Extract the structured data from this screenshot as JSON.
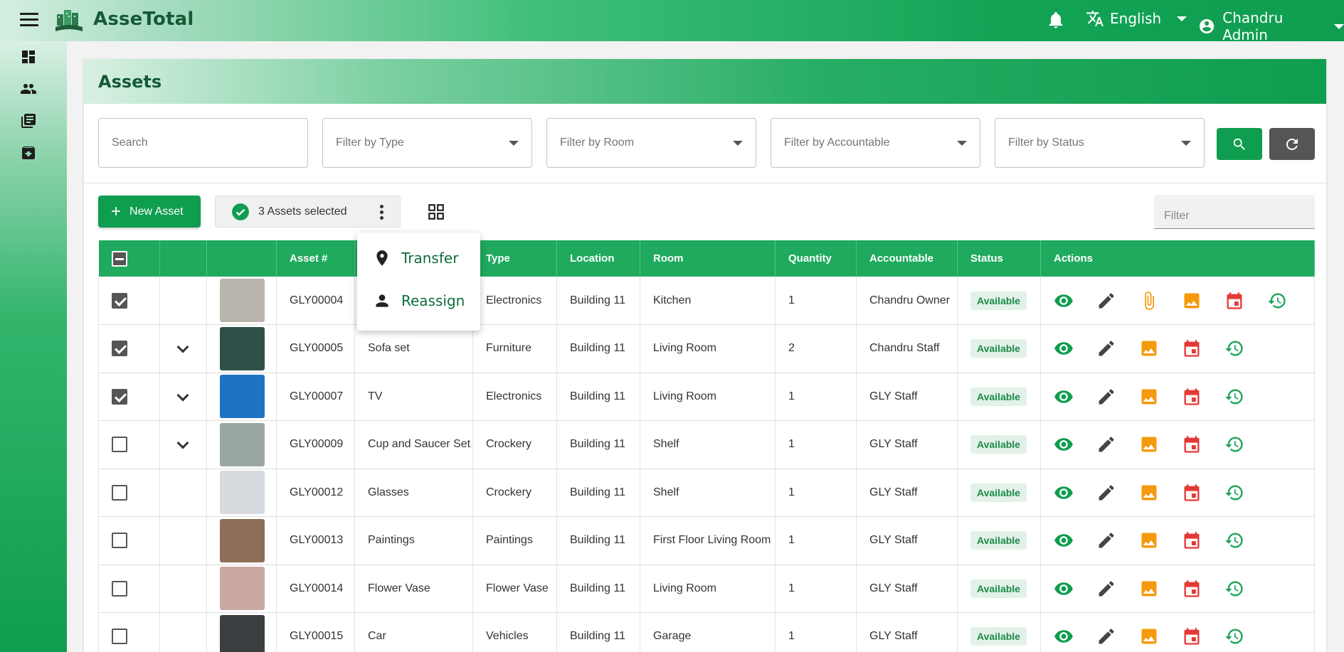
{
  "app": {
    "brand": "AsseTotal"
  },
  "header": {
    "language": "English",
    "user": "Chandru Admin"
  },
  "sidebar": {
    "items": [
      {
        "icon": "dashboard-icon"
      },
      {
        "icon": "people-icon"
      },
      {
        "icon": "library-books-icon"
      },
      {
        "icon": "archive-icon"
      }
    ]
  },
  "page": {
    "title": "Assets"
  },
  "filters": {
    "search_placeholder": "Search",
    "type_placeholder": "Filter by Type",
    "room_placeholder": "Filter by Room",
    "accountable_placeholder": "Filter by Accountable",
    "status_placeholder": "Filter by Status"
  },
  "toolbar": {
    "new_asset_label": "New Asset",
    "selected_label": "3 Assets selected",
    "filter_placeholder": "Filter"
  },
  "menu": {
    "transfer_label": "Transfer",
    "reassign_label": "Reassign"
  },
  "table": {
    "columns": {
      "asset_no": "Asset #",
      "name": "",
      "type": "Type",
      "location": "Location",
      "room": "Room",
      "quantity": "Quantity",
      "accountable": "Accountable",
      "status": "Status",
      "actions": "Actions"
    },
    "rows": [
      {
        "asset_no": "GLY00004",
        "name": "",
        "type": "Electronics",
        "location": "Building 11",
        "room": "Kitchen",
        "quantity": "1",
        "accountable": "Chandru Owner",
        "status": "Available",
        "checked": true,
        "expandable": false,
        "attachment": true,
        "thumb_color": "#b9b4ac"
      },
      {
        "asset_no": "GLY00005",
        "name": "Sofa set",
        "type": "Furniture",
        "location": "Building 11",
        "room": "Living Room",
        "quantity": "2",
        "accountable": "Chandru Staff",
        "status": "Available",
        "checked": true,
        "expandable": true,
        "attachment": false,
        "thumb_color": "#2f5048"
      },
      {
        "asset_no": "GLY00007",
        "name": "TV",
        "type": "Electronics",
        "location": "Building 11",
        "room": "Living Room",
        "quantity": "1",
        "accountable": "GLY Staff",
        "status": "Available",
        "checked": true,
        "expandable": true,
        "attachment": false,
        "thumb_color": "#1f73c4"
      },
      {
        "asset_no": "GLY00009",
        "name": "Cup and Saucer Set",
        "type": "Crockery",
        "location": "Building 11",
        "room": "Shelf",
        "quantity": "1",
        "accountable": "GLY Staff",
        "status": "Available",
        "checked": false,
        "expandable": true,
        "attachment": false,
        "thumb_color": "#9aa7a0"
      },
      {
        "asset_no": "GLY00012",
        "name": "Glasses",
        "type": "Crockery",
        "location": "Building 11",
        "room": "Shelf",
        "quantity": "1",
        "accountable": "GLY Staff",
        "status": "Available",
        "checked": false,
        "expandable": false,
        "attachment": false,
        "thumb_color": "#d7dbe0"
      },
      {
        "asset_no": "GLY00013",
        "name": "Paintings",
        "type": "Paintings",
        "location": "Building 11",
        "room": "First Floor Living Room",
        "quantity": "1",
        "accountable": "GLY Staff",
        "status": "Available",
        "checked": false,
        "expandable": false,
        "attachment": false,
        "thumb_color": "#8e6e58"
      },
      {
        "asset_no": "GLY00014",
        "name": "Flower Vase",
        "type": "Flower Vase",
        "location": "Building 11",
        "room": "Living Room",
        "quantity": "1",
        "accountable": "GLY Staff",
        "status": "Available",
        "checked": false,
        "expandable": false,
        "attachment": false,
        "thumb_color": "#c9a8a2"
      },
      {
        "asset_no": "GLY00015",
        "name": "Car",
        "type": "Vehicles",
        "location": "Building 11",
        "room": "Garage",
        "quantity": "1",
        "accountable": "GLY Staff",
        "status": "Available",
        "checked": false,
        "expandable": false,
        "attachment": false,
        "thumb_color": "#3c3f42"
      }
    ]
  },
  "colors": {
    "accent": "#0f9d4f",
    "view": "#0f9d4f",
    "edit": "#444444",
    "image": "#f59a0c",
    "calendar": "#e53935",
    "history": "#1aa35a"
  }
}
